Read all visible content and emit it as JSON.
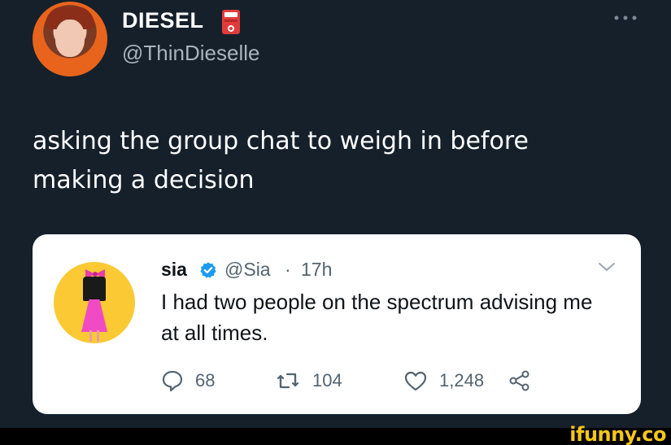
{
  "tweet": {
    "author_name": "DIESEL",
    "author_handle": "@ThinDieselle",
    "text": "asking the group chat to weigh in before making a decision",
    "more_icon": "more-horizontal-icon",
    "badge_icon": "fuel-pump-icon"
  },
  "quoted_tweet": {
    "author_name": "sia",
    "author_handle": "@Sia",
    "separator": "·",
    "time": "17h",
    "text": "I had two people on the spectrum advising me at all times.",
    "stats": {
      "replies": "68",
      "retweets": "104",
      "likes": "1,248"
    },
    "icons": {
      "verified": "verified-badge-icon",
      "menu": "chevron-down-icon",
      "reply": "reply-bubble-icon",
      "retweet": "retweet-icon",
      "like": "heart-icon",
      "share": "share-icon"
    }
  },
  "watermark": "ifunny.co",
  "colors": {
    "background": "#15202b",
    "card": "#ffffff",
    "muted_text": "#536471",
    "verified_blue": "#1d9bf0",
    "watermark_yellow": "#f6c619"
  }
}
